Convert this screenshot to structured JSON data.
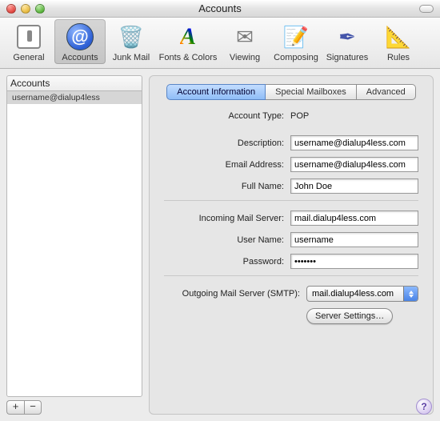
{
  "titlebar": {
    "title": "Accounts"
  },
  "toolbar": {
    "items": [
      {
        "label": "General"
      },
      {
        "label": "Accounts"
      },
      {
        "label": "Junk Mail"
      },
      {
        "label": "Fonts & Colors"
      },
      {
        "label": "Viewing"
      },
      {
        "label": "Composing"
      },
      {
        "label": "Signatures"
      },
      {
        "label": "Rules"
      }
    ]
  },
  "sidebar": {
    "header": "Accounts",
    "items": [
      {
        "label": "username@dialup4less"
      }
    ],
    "add": "+",
    "remove": "−"
  },
  "tabs": [
    {
      "label": "Account Information"
    },
    {
      "label": "Special Mailboxes"
    },
    {
      "label": "Advanced"
    }
  ],
  "form": {
    "account_type_label": "Account Type:",
    "account_type_value": "POP",
    "description_label": "Description:",
    "description_value": "username@dialup4less.com",
    "email_label": "Email Address:",
    "email_value": "username@dialup4less.com",
    "fullname_label": "Full Name:",
    "fullname_value": "John Doe",
    "incoming_label": "Incoming Mail Server:",
    "incoming_value": "mail.dialup4less.com",
    "username_label": "User Name:",
    "username_value": "username",
    "password_label": "Password:",
    "password_value": "•••••••",
    "smtp_label": "Outgoing Mail Server (SMTP):",
    "smtp_value": "mail.dialup4less.com",
    "server_settings_label": "Server Settings…"
  },
  "help": "?"
}
